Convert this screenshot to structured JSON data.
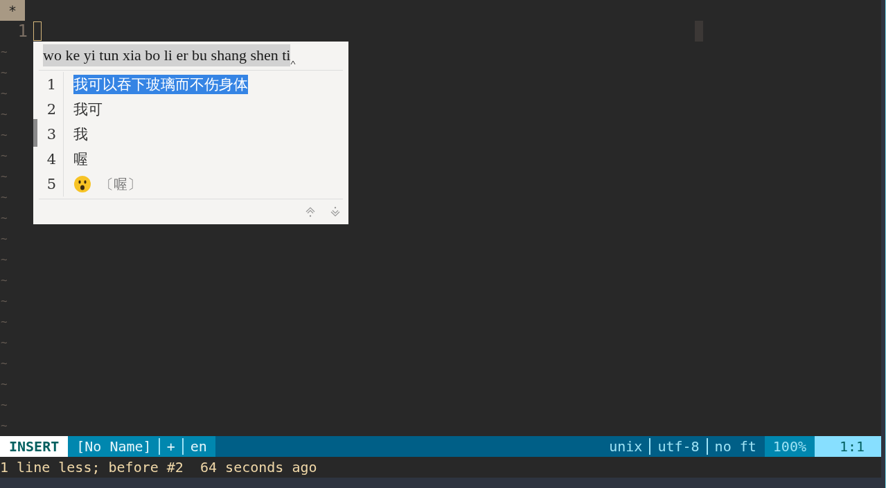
{
  "tabline": {
    "label": "*"
  },
  "buffer": {
    "lines": [
      {
        "number": "1"
      }
    ],
    "filler": [
      "~",
      "~",
      "~",
      "~",
      "~",
      "~",
      "~",
      "~",
      "~",
      "~",
      "~",
      "~",
      "~",
      "~",
      "~",
      "~",
      "~",
      "~",
      "~"
    ]
  },
  "ime": {
    "preedit": "wo ke yi tun xia bo li er bu shang shen ti",
    "candidates": [
      {
        "number": "1",
        "kind": "text",
        "text": "我可以吞下玻璃而不伤身体",
        "selected": true
      },
      {
        "number": "2",
        "kind": "text",
        "text": "我可",
        "selected": false
      },
      {
        "number": "3",
        "kind": "text",
        "text": "我",
        "selected": false
      },
      {
        "number": "4",
        "kind": "text",
        "text": "喔",
        "selected": false
      },
      {
        "number": "5",
        "kind": "emoji",
        "comment": "〔喔〕",
        "selected": false
      }
    ]
  },
  "statusline": {
    "mode": "INSERT",
    "left": [
      "[No Name]",
      "+",
      "en"
    ],
    "right": [
      "unix",
      "utf-8",
      "no ft"
    ],
    "percent": "100%",
    "position": "1:1"
  },
  "message": "1 line less; before #2  64 seconds ago"
}
